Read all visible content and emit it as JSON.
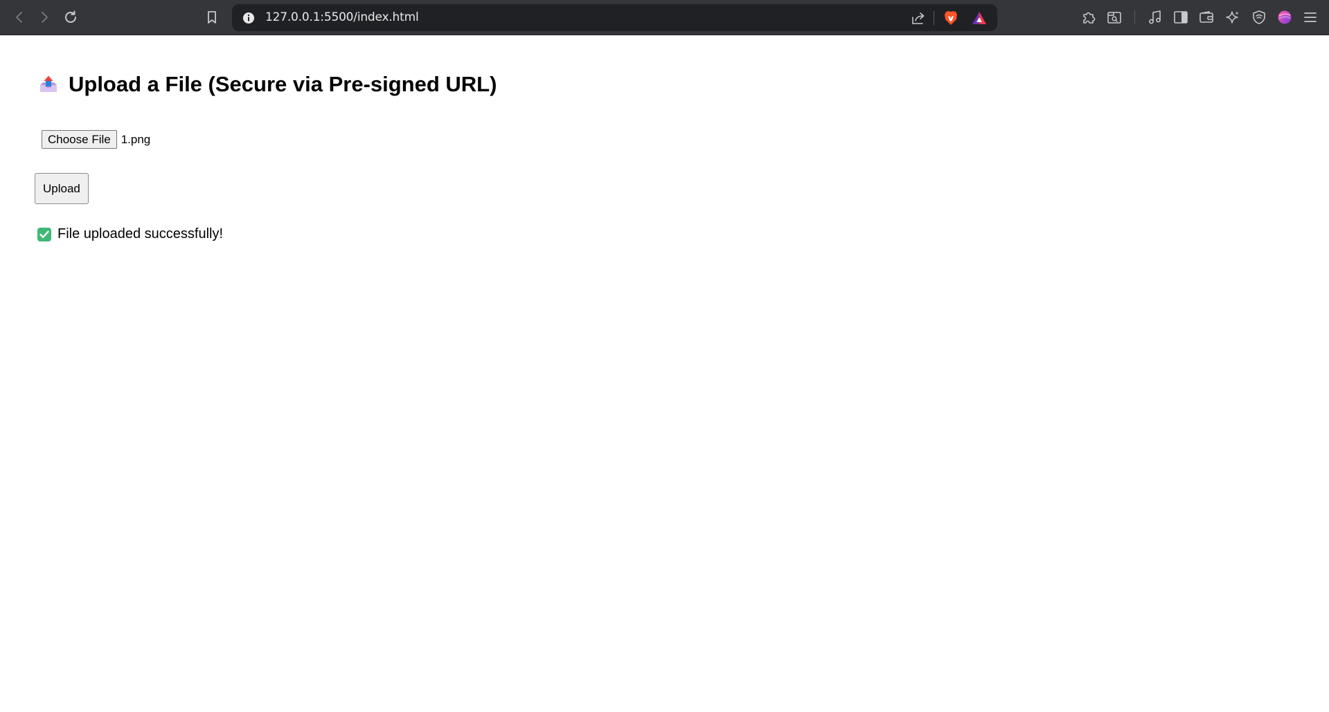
{
  "browser": {
    "url": "127.0.0.1:5500/index.html",
    "icons": {
      "back": "arrow-left-icon",
      "forward": "arrow-right-icon",
      "reload": "reload-icon",
      "bookmark": "bookmark-icon",
      "site_info": "info-icon",
      "share": "share-icon",
      "brave_shields": "brave-lion-icon",
      "rewards": "triangle-icon",
      "extensions": "puzzle-icon",
      "tab_search": "tab-search-icon",
      "media": "music-note-icon",
      "sidebar": "sidebar-icon",
      "wallet": "wallet-icon",
      "leo": "sparkle-icon",
      "vpn": "shield-icon",
      "profile": "avatar",
      "menu": "hamburger-icon"
    },
    "colors": {
      "toolbar_bg": "#35363a",
      "omnibox_bg": "#202124",
      "brave_orange": "#fb542b"
    }
  },
  "page": {
    "title": "Upload a File (Secure via Pre-signed URL)",
    "title_icon": "outbox-tray-icon",
    "file_input": {
      "button_label": "Choose File",
      "selected_file": "1.png"
    },
    "upload_button_label": "Upload",
    "status": {
      "icon": "check-mark-button-icon",
      "text": "File uploaded successfully!",
      "color": "#3fb876"
    }
  }
}
